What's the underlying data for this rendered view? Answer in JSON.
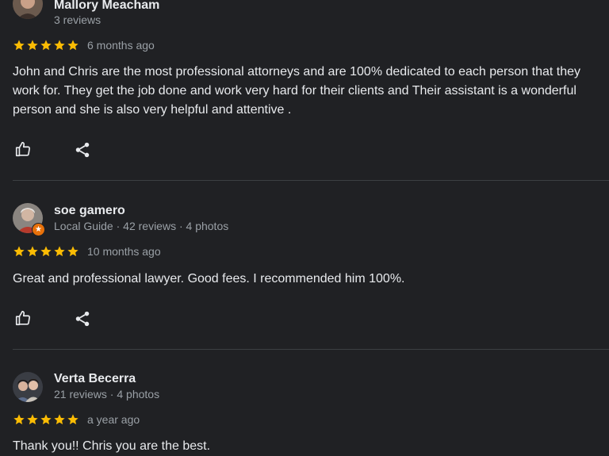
{
  "colors": {
    "background": "#202124",
    "star": "#fbbc04",
    "text_primary": "#e8eaed",
    "text_secondary": "#9aa0a6",
    "divider": "#3c4043",
    "local_guide_badge": "#e8710a"
  },
  "reviews": [
    {
      "author": "Mallory Meacham",
      "meta": "3 reviews",
      "rating": 5,
      "date": "6 months ago",
      "text": "John and Chris are the most professional attorneys and are 100% dedicated to each person that they work for. They get the job done and work very hard for their clients and Their assistant is a wonderful person and she is also very helpful and attentive .",
      "actions": [
        "like-icon",
        "share-icon"
      ]
    },
    {
      "author": "soe gamero",
      "meta": "Local Guide · 42 reviews · 4 photos",
      "local_guide": true,
      "rating": 5,
      "date": "10 months ago",
      "text": "Great and professional lawyer. Good fees. I recommended him 100%.",
      "actions": [
        "like-icon",
        "share-icon"
      ]
    },
    {
      "author": "Verta Becerra",
      "meta": "21 reviews · 4 photos",
      "rating": 5,
      "date": "a year ago",
      "text": "Thank you!! Chris you are the best."
    }
  ]
}
